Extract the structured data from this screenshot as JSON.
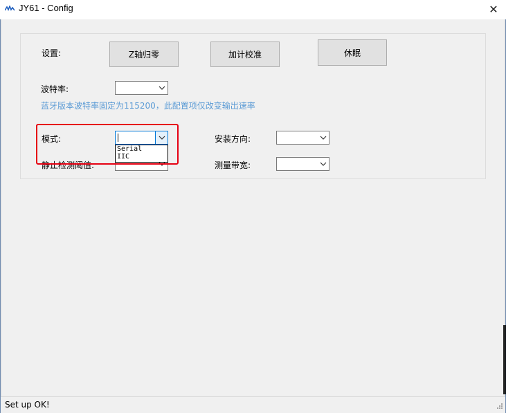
{
  "window": {
    "title": "JY61 - Config",
    "close_glyph": "✕"
  },
  "settings": {
    "label": "设置:",
    "buttons": {
      "zero_z": "Z轴归零",
      "accel_calib": "加计校准",
      "sleep": "休眠"
    }
  },
  "baud": {
    "label": "波特率:",
    "value": "",
    "hint": "蓝牙版本波特率固定为115200，此配置项仅改变输出速率"
  },
  "mode": {
    "label": "模式:",
    "value": "",
    "options": [
      "Serial",
      "IIC"
    ]
  },
  "static_threshold": {
    "label": "静止检测阈值:",
    "value": ""
  },
  "install_direction": {
    "label": "安装方向:",
    "value": ""
  },
  "bandwidth": {
    "label": "测量带宽:",
    "value": ""
  },
  "status": {
    "text": "Set up OK!"
  },
  "colors": {
    "highlight": "#e60012",
    "hint_text": "#5b9bd5",
    "focus": "#0078d7"
  }
}
